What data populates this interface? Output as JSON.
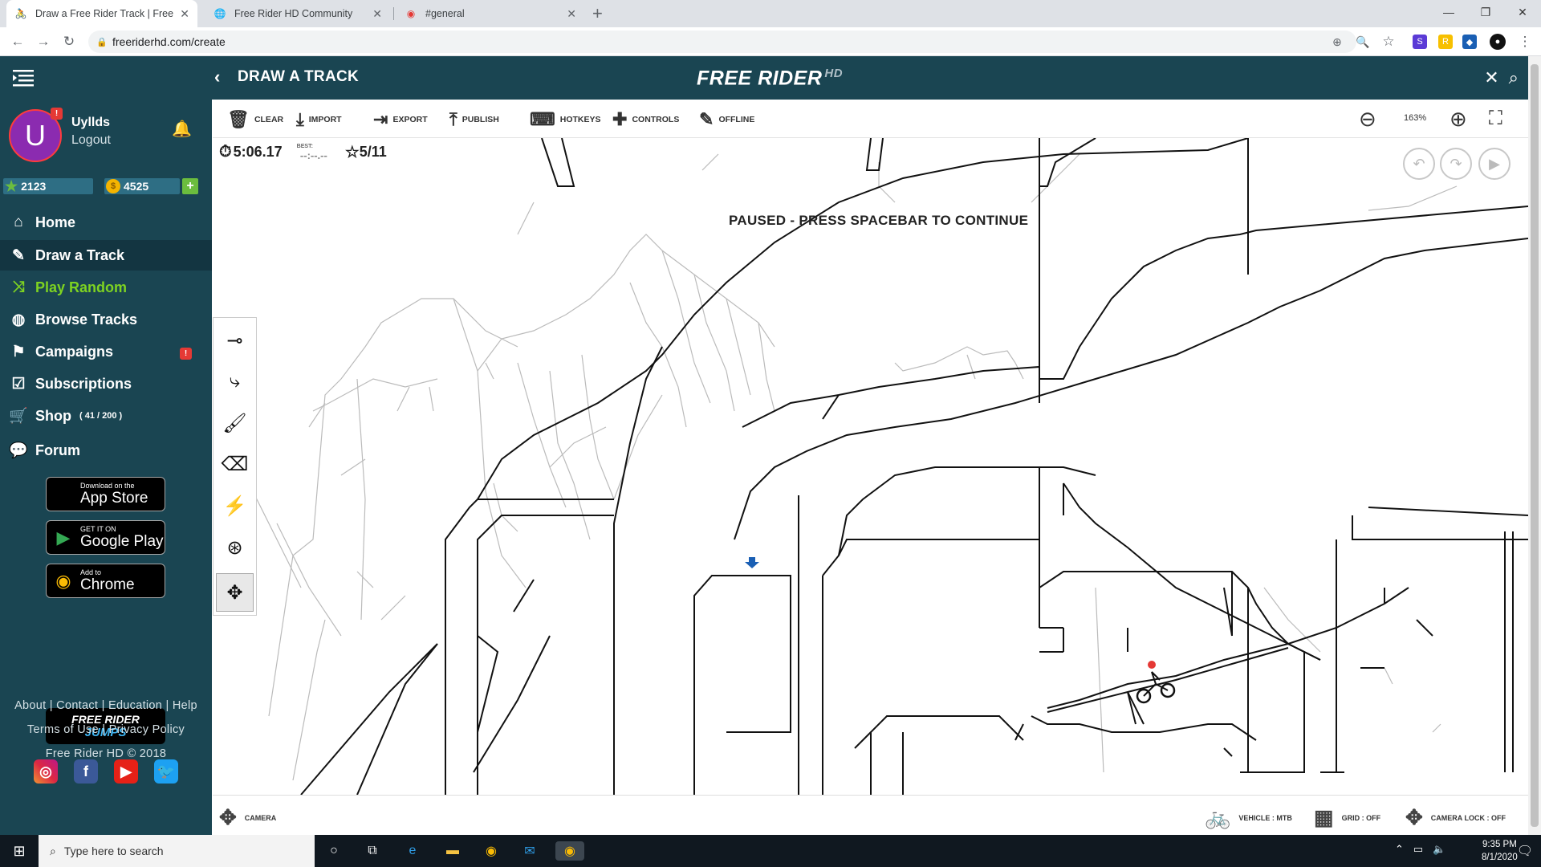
{
  "browser": {
    "tabs": [
      {
        "title": "Draw a Free Rider Track | Free Ric",
        "active": true
      },
      {
        "title": "Free Rider HD Community",
        "active": false
      },
      {
        "title": "#general",
        "active": false
      }
    ],
    "url": "freeriderhd.com/create"
  },
  "header": {
    "title": "DRAW A TRACK",
    "logo": "FREE RIDER",
    "logo_hd": "HD"
  },
  "user": {
    "initial": "U",
    "name": "Uyllds",
    "logout": "Logout",
    "stars": "2123",
    "coins": "4525"
  },
  "nav": [
    {
      "label": "Home",
      "icon": "home-icon"
    },
    {
      "label": "Draw a Track",
      "icon": "edit-icon"
    },
    {
      "label": "Play Random",
      "icon": "shuffle-icon"
    },
    {
      "label": "Browse Tracks",
      "icon": "globe-icon"
    },
    {
      "label": "Campaigns",
      "icon": "campaigns-icon"
    },
    {
      "label": "Subscriptions",
      "icon": "checkbox-icon"
    },
    {
      "label": "Shop",
      "icon": "cart-icon",
      "sub": "( 41 / 200 )"
    },
    {
      "label": "Forum",
      "icon": "forum-icon"
    }
  ],
  "stores": [
    {
      "line1": "Download on the",
      "line2": "App Store"
    },
    {
      "line1": "GET IT ON",
      "line2": "Google Play"
    },
    {
      "line1": "Add to",
      "line2": "Chrome"
    }
  ],
  "jumps": {
    "line1": "FREE RIDER",
    "line2": "JUMPS"
  },
  "footer": {
    "links1": "About | Contact | Education | Help",
    "links2": "Terms of Use  |  Privacy Policy",
    "copyright": "Free Rider HD © 2018"
  },
  "toolbar": {
    "clear": "CLEAR",
    "import": "IMPORT",
    "export": "EXPORT",
    "publish": "PUBLISH",
    "hotkeys": "HOTKEYS",
    "controls": "CONTROLS",
    "offline": "OFFLINE",
    "zoom": "163%"
  },
  "hud": {
    "time_label": "TIME:",
    "time": "5:06.17",
    "best_label": "BEST:",
    "best": "--:--.--",
    "stars": "5/11"
  },
  "paused_message": "PAUSED - PRESS SPACEBAR TO CONTINUE",
  "bottom": {
    "camera": "CAMERA",
    "vehicle": "VEHICLE : MTB",
    "grid": "GRID : OFF",
    "camera_lock": "CAMERA LOCK : OFF"
  },
  "taskbar": {
    "search_placeholder": "Type here to search",
    "time": "9:35 PM",
    "date": "8/1/2020"
  },
  "colors": {
    "header_bg": "#1a4552",
    "accent_green": "#7ed321",
    "badge_red": "#e53935"
  }
}
